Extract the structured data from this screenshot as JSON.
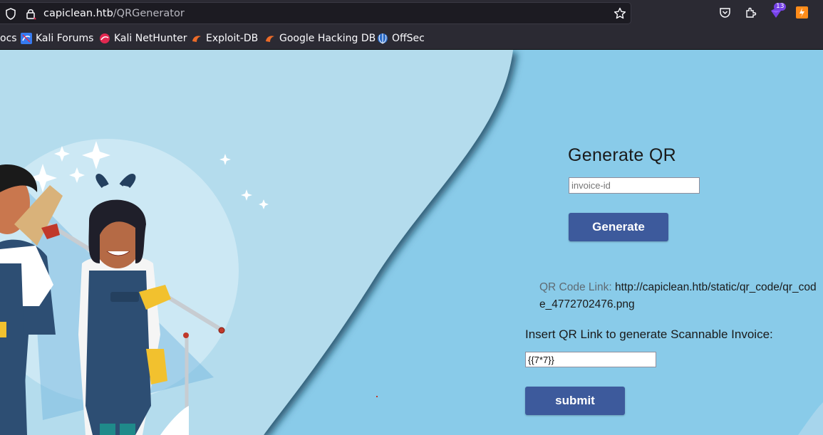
{
  "browser": {
    "url_host": "capiclean.htb",
    "url_path": "/QRGenerator",
    "extension_badge": "13",
    "bookmarks": [
      {
        "label": "ocs",
        "icon": "docs-icon"
      },
      {
        "label": "Kali Forums",
        "icon": "kali-forums-icon"
      },
      {
        "label": "Kali NetHunter",
        "icon": "kali-nethunter-icon"
      },
      {
        "label": "Exploit-DB",
        "icon": "exploit-db-icon"
      },
      {
        "label": "Google Hacking DB",
        "icon": "ghdb-icon"
      },
      {
        "label": "OffSec",
        "icon": "offsec-icon"
      }
    ]
  },
  "page": {
    "title": "Generate QR",
    "invoice_placeholder": "invoice-id",
    "generate_label": "Generate",
    "qr_link_label": "QR Code Link:",
    "qr_link_value": "http://capiclean.htb/static/qr_code/qr_code_4772702476.png",
    "insert_label": "Insert QR Link to generate Scannable Invoice:",
    "qr_input_value": "{{7*7}}",
    "submit_label": "submit"
  },
  "colors": {
    "button": "#3d5a9c",
    "page_bg": "#89cbe9",
    "wave_left": "#b4dced"
  }
}
